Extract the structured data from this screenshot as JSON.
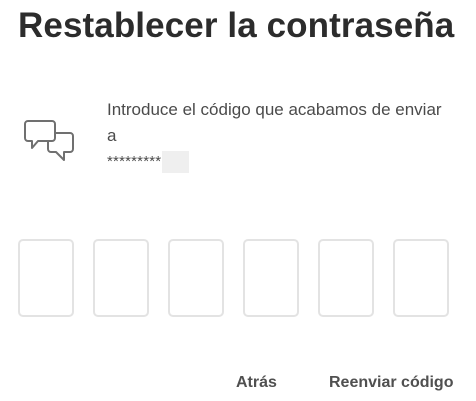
{
  "page": {
    "title": "Restablecer la contraseña"
  },
  "message": {
    "icon": "chat-bubbles-icon",
    "text": "Introduce el código que acabamos de enviar a",
    "masked_destination": "*********"
  },
  "code_input": {
    "boxes": [
      "",
      "",
      "",
      "",
      "",
      ""
    ]
  },
  "actions": {
    "back_label": "Atrás",
    "resend_label": "Reenviar código"
  }
}
